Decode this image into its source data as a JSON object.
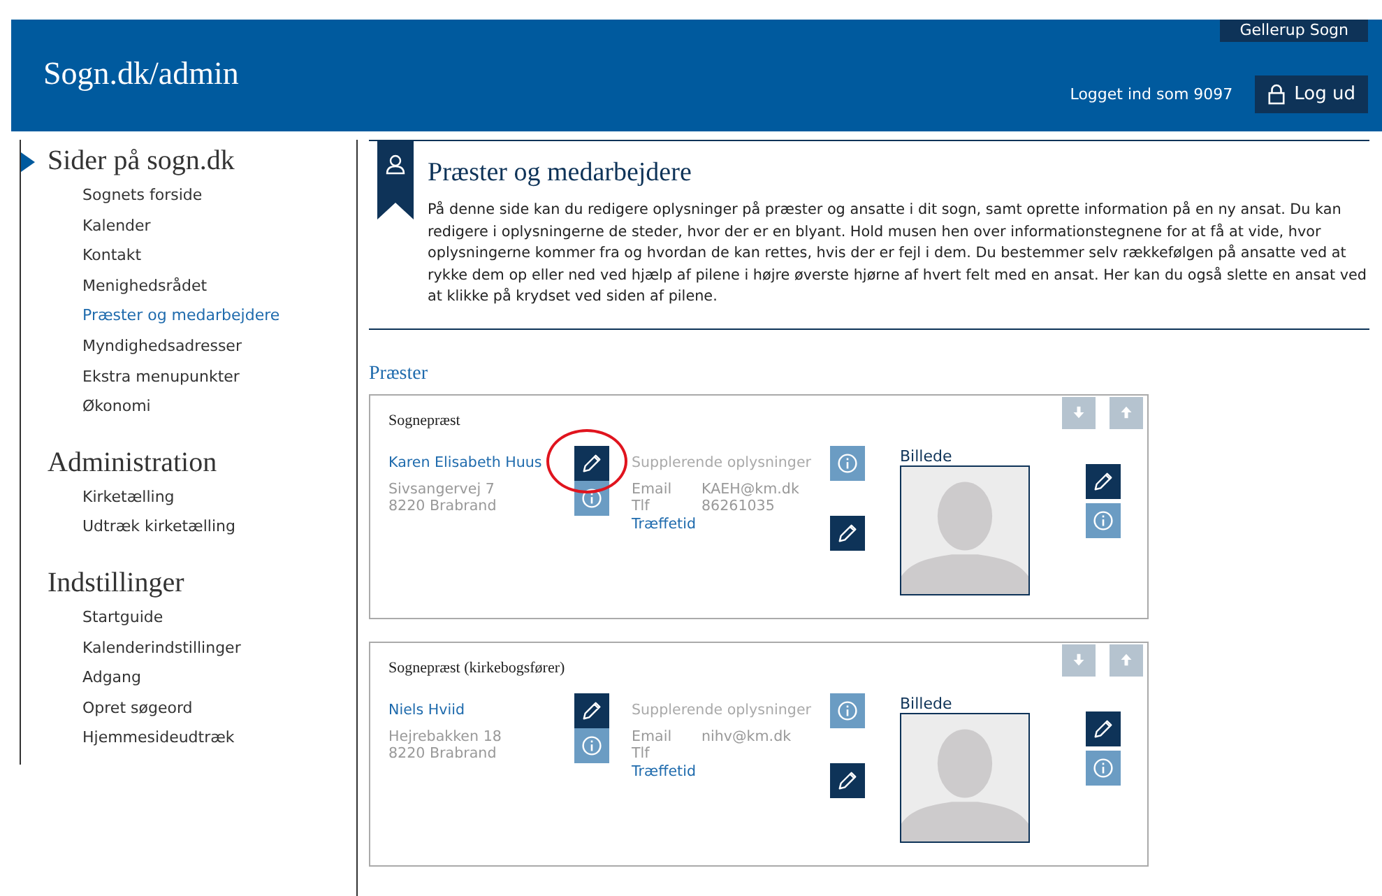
{
  "header": {
    "site_title": "Sogn.dk/admin",
    "parish_button": "Gellerup Sogn",
    "logged_in": "Logget ind som 9097",
    "logout_button": "Log ud"
  },
  "sidebar": {
    "sections": [
      {
        "title": "Sider på sogn.dk",
        "active": true,
        "items": [
          {
            "label": "Sognets forside",
            "selected": false
          },
          {
            "label": "Kalender",
            "selected": false
          },
          {
            "label": "Kontakt",
            "selected": false
          },
          {
            "label": "Menighedsrådet",
            "selected": false
          },
          {
            "label": "Præster og medarbejdere",
            "selected": true
          },
          {
            "label": "Myndighedsadresser",
            "selected": false
          },
          {
            "label": "Ekstra menupunkter",
            "selected": false
          },
          {
            "label": "Økonomi",
            "selected": false
          }
        ]
      },
      {
        "title": "Administration",
        "active": false,
        "items": [
          {
            "label": "Kirketælling",
            "selected": false
          },
          {
            "label": "Udtræk kirketælling",
            "selected": false
          }
        ]
      },
      {
        "title": "Indstillinger",
        "active": false,
        "items": [
          {
            "label": "Startguide",
            "selected": false
          },
          {
            "label": "Kalenderindstillinger",
            "selected": false
          },
          {
            "label": "Adgang",
            "selected": false
          },
          {
            "label": "Opret søgeord",
            "selected": false
          },
          {
            "label": "Hjemmesideudtræk",
            "selected": false
          }
        ]
      }
    ]
  },
  "page": {
    "title": "Præster og medarbejdere",
    "description": "På denne side kan du redigere oplysninger på præster og ansatte i dit sogn, samt oprette information på en ny ansat. Du kan redigere i oplysningerne de steder, hvor der er en blyant. Hold musen hen over informationstegnene for at få at vide, hvor oplysningerne kommer fra og hvordan de kan rettes, hvis der er fejl i dem. Du bestemmer selv rækkefølgen på ansatte ved at rykke dem op eller ned ved hjælp af pilene i højre øverste hjørne af hvert felt med en ansat. Her kan du også slette en ansat ved at klikke på krydset ved siden af pilene."
  },
  "section_title": "Præster",
  "staff": [
    {
      "role": "Sognepræst",
      "name": "Karen Elisabeth Huus",
      "address_lines": [
        "Sivsangervej 7",
        "8220 Brabrand"
      ],
      "extra_label": "Supplerende oplysninger",
      "email_label": "Email",
      "email": "KAEH@km.dk",
      "phone_label": "Tlf",
      "phone": "86261035",
      "office_hours": "Træffetid",
      "picture_label": "Billede",
      "name_edit_circled": true
    },
    {
      "role": "Sognepræst (kirkebogsfører)",
      "name": "Niels Hviid",
      "address_lines": [
        "Hejrebakken 18",
        "8220 Brabrand"
      ],
      "extra_label": "Supplerende oplysninger",
      "email_label": "Email",
      "email": "nihv@km.dk",
      "phone_label": "Tlf",
      "office_hours": "Træffetid",
      "picture_label": "Billede",
      "name_edit_circled": false
    }
  ]
}
